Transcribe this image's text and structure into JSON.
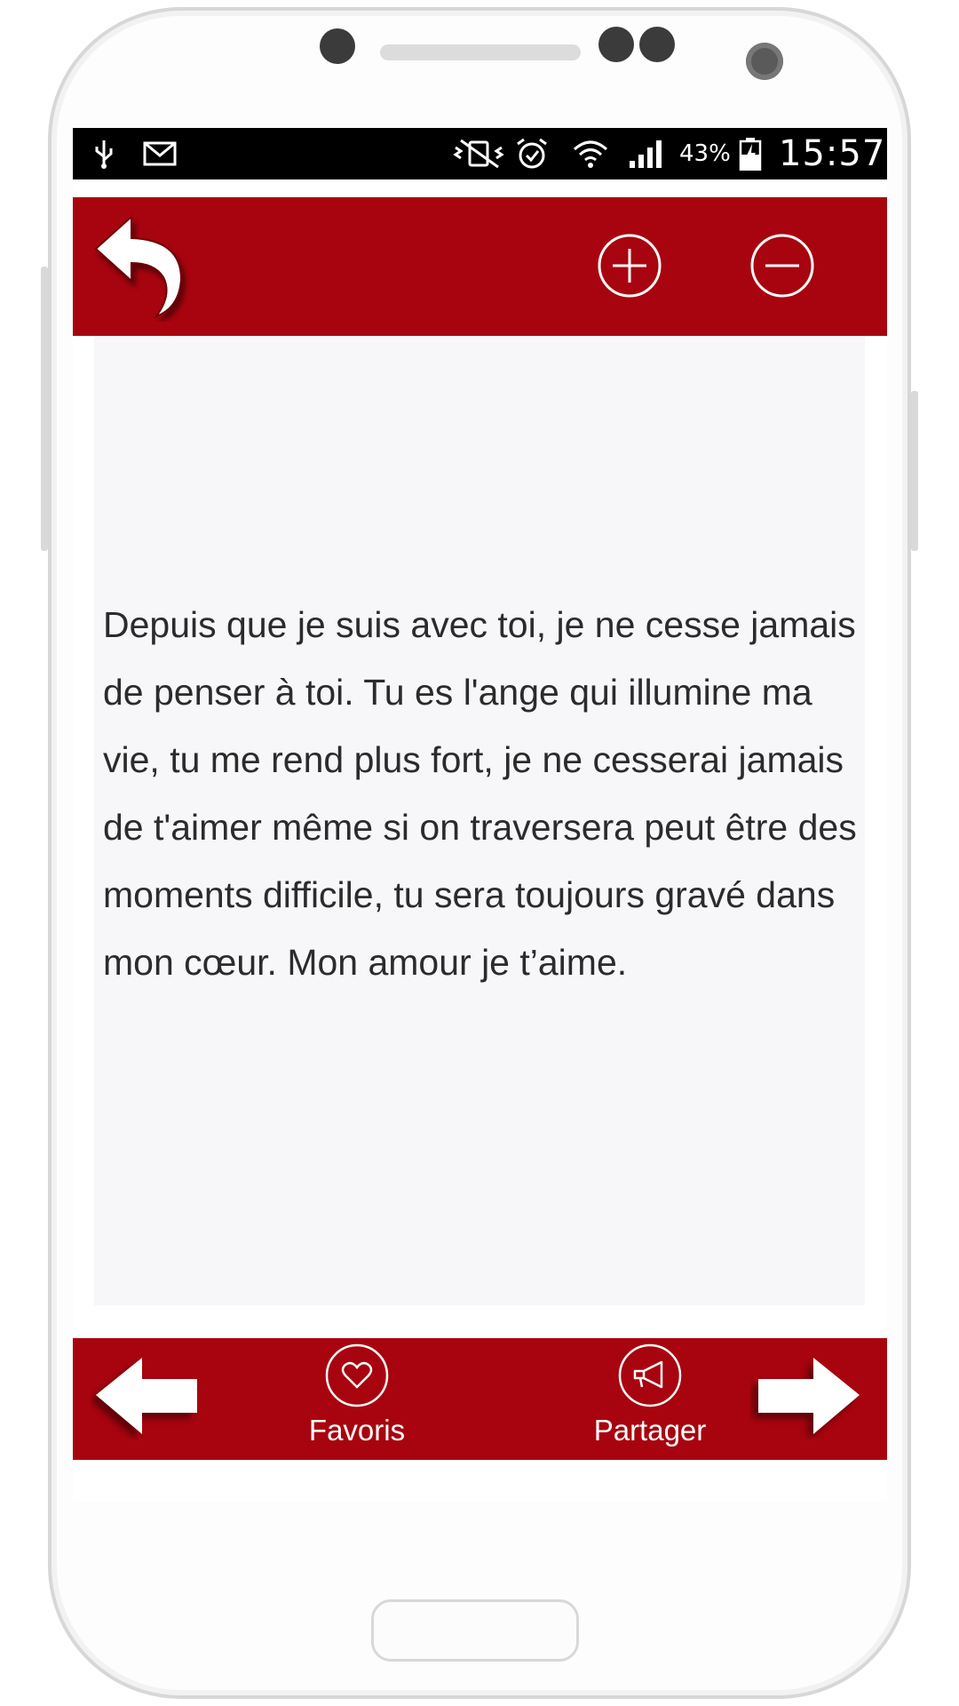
{
  "status_bar": {
    "battery_percent": "43%",
    "time": "15:57",
    "icons": [
      "usb-icon",
      "gmail-icon",
      "vibrate-icon",
      "alarm-icon",
      "wifi-icon",
      "signal-icon",
      "battery-icon"
    ]
  },
  "toolbar": {
    "back_icon": "back-arrow-icon",
    "zoom_in_icon": "plus-circle-icon",
    "zoom_out_icon": "minus-circle-icon"
  },
  "message": {
    "text": "Depuis que je suis avec toi, je ne cesse jamais de penser à toi. Tu es l'ange qui illumine ma vie, tu me rend plus fort, je ne cesserai jamais de t'aimer même si on traversera peut être des moments difficile, tu sera toujours gravé dans mon cœur. Mon amour je t’aime."
  },
  "bottom_bar": {
    "favorites_label": "Favoris",
    "share_label": "Partager",
    "favorites_icon": "heart-icon",
    "share_icon": "megaphone-icon",
    "prev_icon": "arrow-left-icon",
    "next_icon": "arrow-right-icon"
  },
  "colors": {
    "accent_red": "#a8040f",
    "content_background": "#f7f6f9",
    "text": "#2b2b2b"
  }
}
